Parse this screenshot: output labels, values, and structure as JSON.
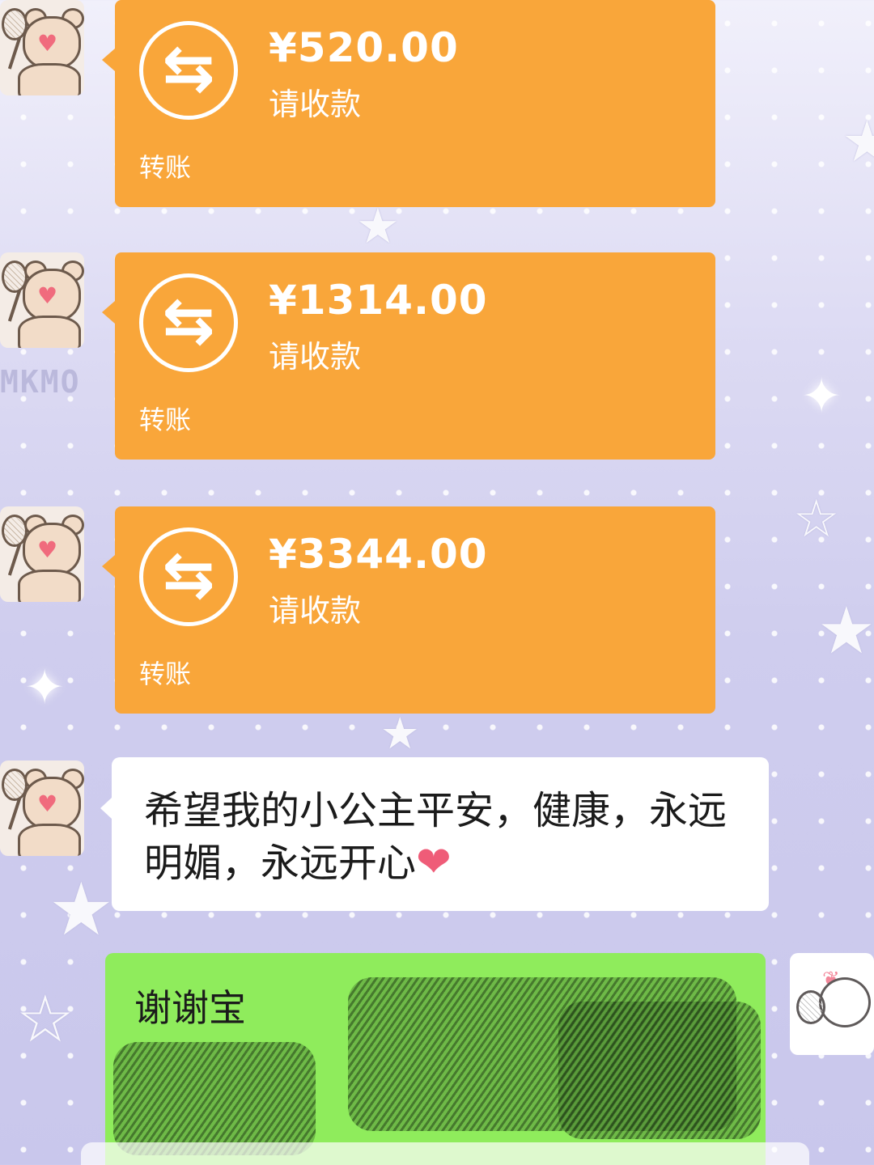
{
  "chat": {
    "transfers": [
      {
        "amount": "¥520.00",
        "status": "请收款",
        "kind": "转账",
        "icon": "transfer-arrows-icon"
      },
      {
        "amount": "¥1314.00",
        "status": "请收款",
        "kind": "转账",
        "icon": "transfer-arrows-icon"
      },
      {
        "amount": "¥3344.00",
        "status": "请收款",
        "kind": "转账",
        "icon": "transfer-arrows-icon"
      }
    ],
    "message_incoming": "希望我的小公主平安，健康，永远明媚，永远开心",
    "message_outgoing": "谢谢宝"
  },
  "background": {
    "watermark": "MKMO"
  },
  "colors": {
    "transfer_bubble": "#f9a63a",
    "incoming_bubble": "#ffffff",
    "outgoing_bubble": "#8fec5c",
    "heart": "#ef5c78"
  },
  "icons": {
    "heart_emoji": "❤",
    "transfer_glyph": "⇆"
  }
}
